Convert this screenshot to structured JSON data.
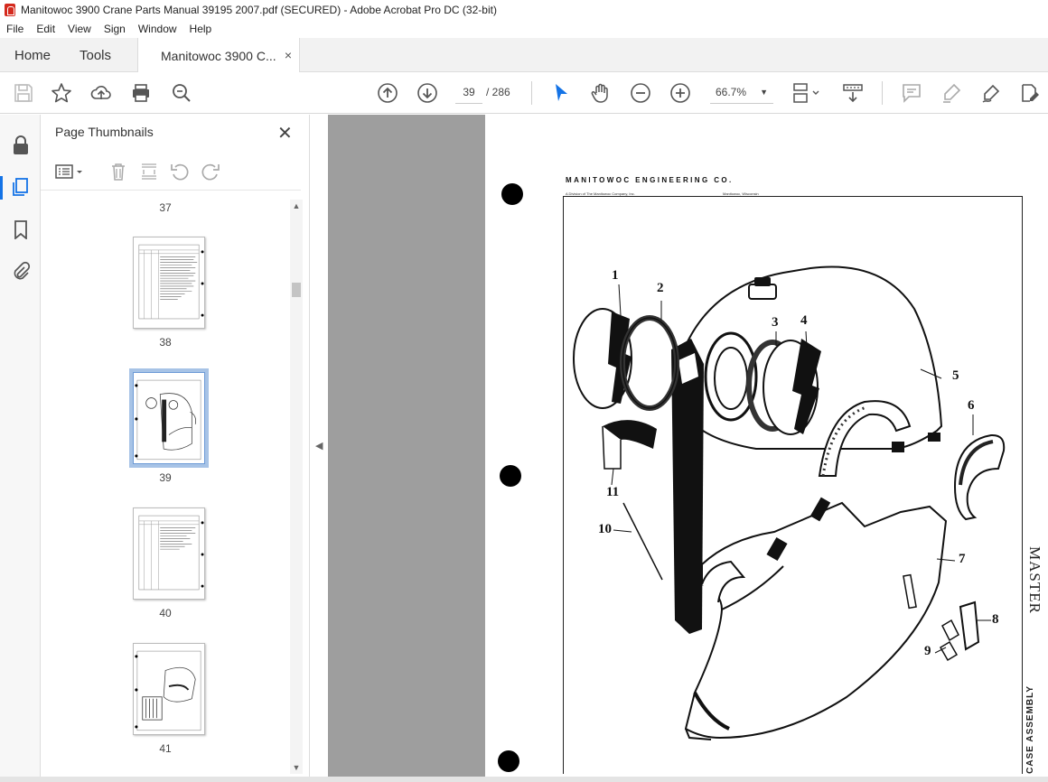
{
  "window": {
    "title": "Manitowoc 3900 Crane Parts Manual 39195 2007.pdf (SECURED) - Adobe Acrobat Pro DC (32-bit)"
  },
  "menu": [
    "File",
    "Edit",
    "View",
    "Sign",
    "Window",
    "Help"
  ],
  "tabs": {
    "home": "Home",
    "tools": "Tools",
    "document": "Manitowoc 3900 C...",
    "close": "×"
  },
  "toolbar": {
    "current_page": "39",
    "total_pages": "/ 286",
    "zoom": "66.7%",
    "zoom_dropdown": "▼"
  },
  "icons": {
    "save": "save-icon",
    "star": "star-icon",
    "upload": "upload-icon",
    "print": "print-icon",
    "search": "magnify-icon",
    "prev": "arrow-up-circle-icon",
    "next": "arrow-down-circle-icon",
    "select": "cursor-icon",
    "hand": "hand-icon",
    "zoom_out": "minus-circle-icon",
    "zoom_in": "plus-circle-icon",
    "fit": "fit-page-icon",
    "scroll": "scroll-mode-icon",
    "comment": "comment-icon",
    "highlight": "highlight-icon",
    "sign": "pen-icon",
    "edit": "edit-pdf-icon"
  },
  "panel": {
    "title": "Page Thumbnails",
    "close": "✕",
    "thumbnails": [
      {
        "label": "37"
      },
      {
        "label": "38"
      },
      {
        "label": "39",
        "selected": true
      },
      {
        "label": "40"
      },
      {
        "label": "41"
      }
    ]
  },
  "document": {
    "manufacturer": "MANITOWOC ENGINEERING CO.",
    "subtitle": "A Division of The Manitowoc Company, Inc.",
    "location": "Manitowoc, Wisconsin",
    "side_label": "MASTER",
    "side_title": "CASE ASSEMBLY",
    "callouts": [
      "1",
      "2",
      "3",
      "4",
      "5",
      "6",
      "7",
      "8",
      "9",
      "10",
      "11"
    ]
  },
  "colors": {
    "accent": "#1473e6",
    "canvas": "#9e9e9e",
    "selection": "#a7c3e6"
  }
}
